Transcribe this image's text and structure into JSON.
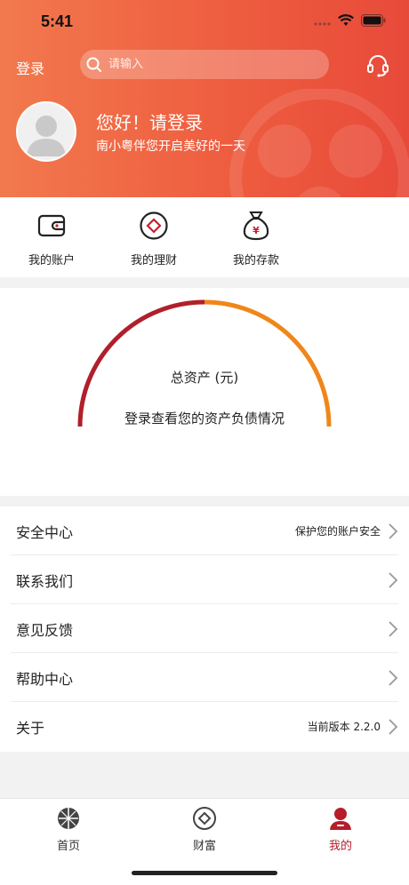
{
  "status_bar": {
    "time": "5:41"
  },
  "header": {
    "login_label": "登录",
    "search_placeholder": "请输入",
    "greeting": "您好！请登录",
    "subtitle": "南小粤伴您开启美好的一天"
  },
  "quick_actions": [
    {
      "label": "我的账户",
      "icon": "wallet-icon"
    },
    {
      "label": "我的理财",
      "icon": "wealth-icon"
    },
    {
      "label": "我的存款",
      "icon": "money-bag-icon"
    }
  ],
  "assets": {
    "title": "总资产 (元)",
    "hint": "登录查看您的资产负债情况",
    "colors": {
      "left_arc": "#b11f2b",
      "right_arc": "#f08619"
    }
  },
  "menu": [
    {
      "label": "安全中心",
      "value": "保护您的账户安全"
    },
    {
      "label": "联系我们",
      "value": ""
    },
    {
      "label": "意见反馈",
      "value": ""
    },
    {
      "label": "帮助中心",
      "value": ""
    },
    {
      "label": "关于",
      "value": "当前版本 2.2.0"
    }
  ],
  "tabs": [
    {
      "label": "首页",
      "icon": "home-globe-icon",
      "active": false
    },
    {
      "label": "财富",
      "icon": "wealth-icon",
      "active": false
    },
    {
      "label": "我的",
      "icon": "user-icon",
      "active": true
    }
  ],
  "accent_color": "#b61c2a"
}
